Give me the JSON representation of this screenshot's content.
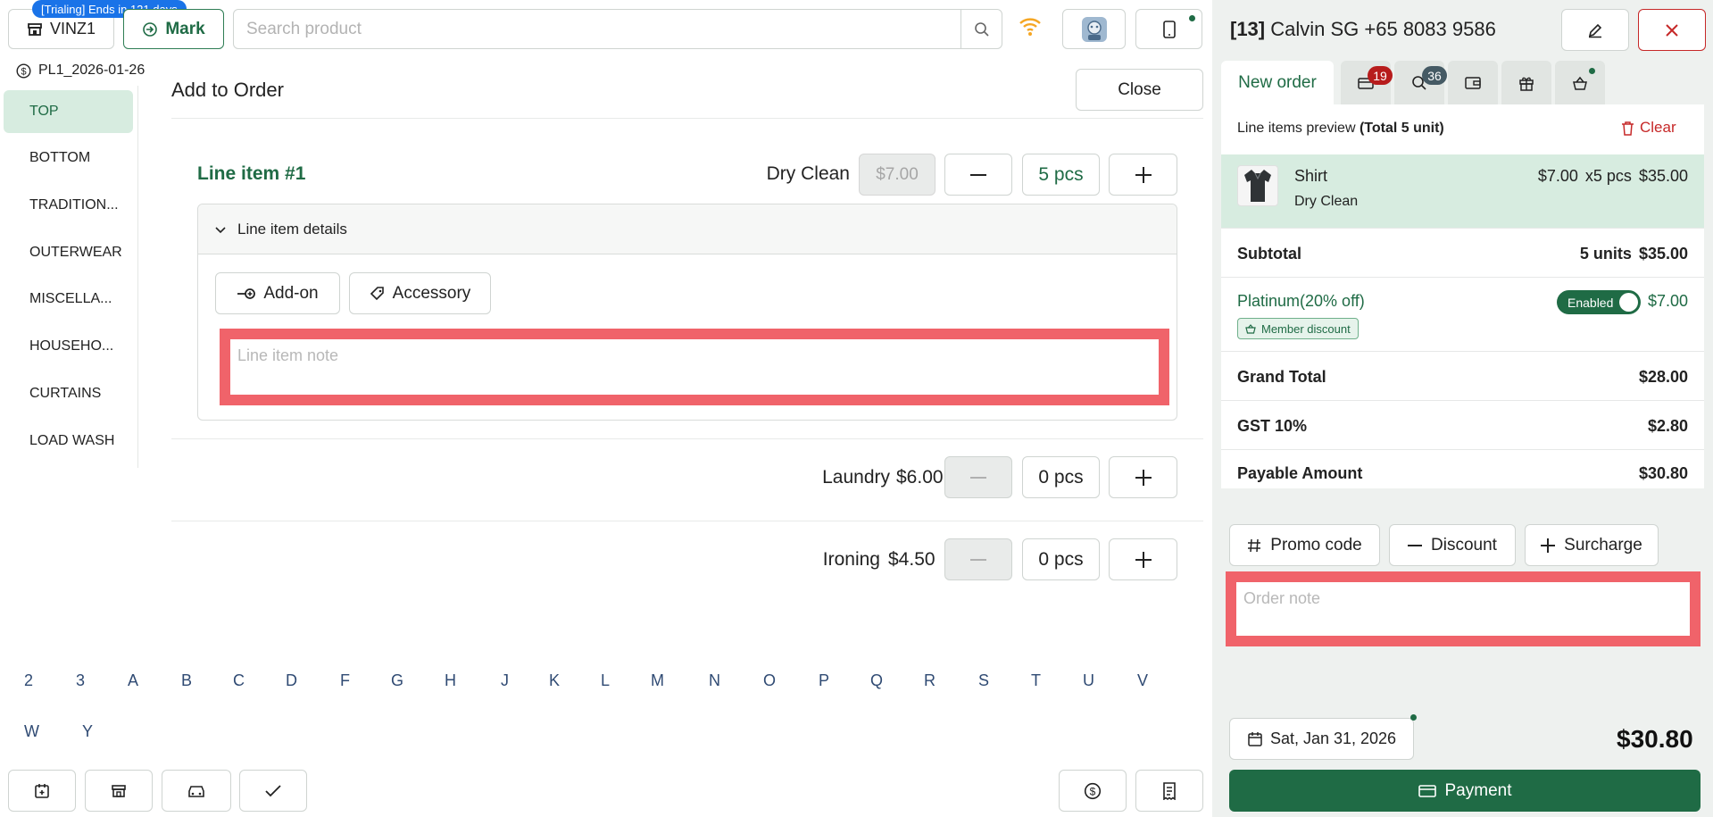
{
  "topbar": {
    "store_label": "VINZ1",
    "trial_badge": "[Trialing] Ends in 121 days",
    "mark_label": "Mark",
    "search_placeholder": "Search product"
  },
  "sidebar": {
    "price_list": "PL1_2026-01-26",
    "categories": [
      "TOP",
      "BOTTOM",
      "TRADITION...",
      "OUTERWEAR",
      "MISCELLA...",
      "HOUSEHO...",
      "CURTAINS",
      "LOAD WASH"
    ]
  },
  "main": {
    "title": "Add to Order",
    "close_label": "Close",
    "line_item_title": "Line item #1",
    "services": [
      {
        "name": "Dry Clean",
        "price": "$7.00",
        "qty": "5 pcs"
      },
      {
        "name": "Laundry",
        "price": "$6.00",
        "qty": "0 pcs"
      },
      {
        "name": "Ironing",
        "price": "$4.50",
        "qty": "0 pcs"
      }
    ],
    "details_label": "Line item details",
    "addon_label": "Add-on",
    "accessory_label": "Accessory",
    "line_note_placeholder": "Line item note"
  },
  "alphabet": [
    "2",
    "3",
    "A",
    "B",
    "C",
    "D",
    "F",
    "G",
    "H",
    "J",
    "K",
    "L",
    "M",
    "N",
    "O",
    "P",
    "Q",
    "R",
    "S",
    "T",
    "U",
    "V",
    "W",
    "Y"
  ],
  "order": {
    "customer_id": "[13]",
    "customer_name": "Calvin SG +65 8083 9586",
    "tabs": {
      "new_order": "New order",
      "badge1": "19",
      "badge2": "36"
    },
    "preview_label": "Line items preview",
    "preview_total": "(Total 5 unit)",
    "clear_label": "Clear",
    "item": {
      "name": "Shirt",
      "service": "Dry Clean",
      "price": "$7.00",
      "qty": "x5 pcs",
      "amount": "$35.00"
    },
    "subtotal_label": "Subtotal",
    "subtotal_units": "5 units",
    "subtotal_value": "$35.00",
    "discount_label": "Platinum(20% off)",
    "toggle_label": "Enabled",
    "discount_value": "$7.00",
    "member_badge": "Member discount",
    "grand_total_label": "Grand Total",
    "grand_total_value": "$28.00",
    "gst_label": "GST 10%",
    "gst_value": "$2.80",
    "payable_label": "Payable Amount",
    "payable_value": "$30.80",
    "promo_label": "Promo code",
    "discount_btn_label": "Discount",
    "surcharge_label": "Surcharge",
    "order_note_placeholder": "Order note",
    "date_label": "Sat, Jan 31, 2026",
    "total": "$30.80",
    "payment_label": "Payment"
  },
  "colors": {
    "brand_green": "#1f6b45",
    "danger_red": "#c62828",
    "highlight_red": "#f0636a",
    "trial_blue": "#1a73e8"
  }
}
